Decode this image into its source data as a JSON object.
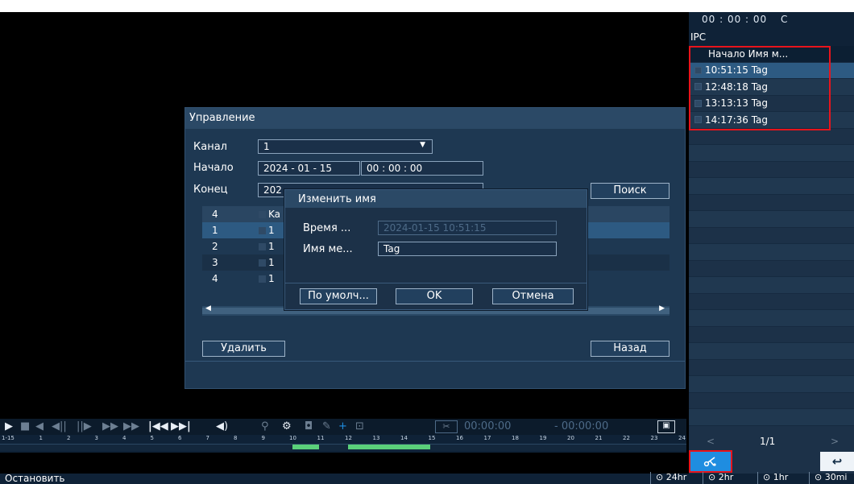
{
  "right_panel": {
    "time": "00 : 00 : 00",
    "time_suffix": "C",
    "channel_label": "IPC",
    "list_header": "Начало  Имя м...",
    "tags": [
      "10:51:15 Tag",
      "12:48:18 Tag",
      "13:13:13 Tag",
      "14:17:36 Tag"
    ],
    "pager": {
      "prev": "<",
      "page": "1/1",
      "next": ">"
    },
    "back_icon": "undo-arrow-icon",
    "clip_icon": "scissors-cut-icon"
  },
  "dialog": {
    "title": "Управление",
    "channel_label": "Канал",
    "channel_value": "1",
    "start_label": "Начало",
    "start_date": "2024 - 01 - 15",
    "start_time": "00 : 00 : 00",
    "end_label": "Конец",
    "end_date": "202",
    "search_button": "Поиск",
    "table": {
      "header": {
        "num": "4",
        "col": "Ka"
      },
      "rows": [
        {
          "num": "1",
          "val": "1"
        },
        {
          "num": "2",
          "val": "1"
        },
        {
          "num": "3",
          "val": "1"
        },
        {
          "num": "4",
          "val": "1"
        }
      ]
    },
    "delete_button": "Удалить",
    "back_button": "Назад"
  },
  "modal": {
    "title": "Изменить имя",
    "time_label": "Время ...",
    "time_value": "2024-01-15 10:51:15",
    "name_label": "Имя ме...",
    "name_value": "Tag",
    "default_button": "По умолч...",
    "ok_button": "OK",
    "cancel_button": "Отмена"
  },
  "playback": {
    "time_start": "00:00:00",
    "time_end": "- 00:00:00",
    "timeline_label": "1-15",
    "hours": [
      "1",
      "2",
      "3",
      "4",
      "5",
      "6",
      "7",
      "8",
      "9",
      "10",
      "11",
      "12",
      "13",
      "14",
      "15",
      "16",
      "17",
      "18",
      "19",
      "20",
      "21",
      "22",
      "23",
      "24"
    ],
    "segments": [
      {
        "start": 10,
        "end": 11
      },
      {
        "start": 12,
        "end": 15
      }
    ]
  },
  "status": {
    "text": "Остановить",
    "zoom": [
      "24hr",
      "2hr",
      "1hr",
      "30mi"
    ]
  },
  "colors": {
    "accent": "#1f8de0",
    "highlight_border": "#e8141c",
    "record": "#5ad07a"
  }
}
